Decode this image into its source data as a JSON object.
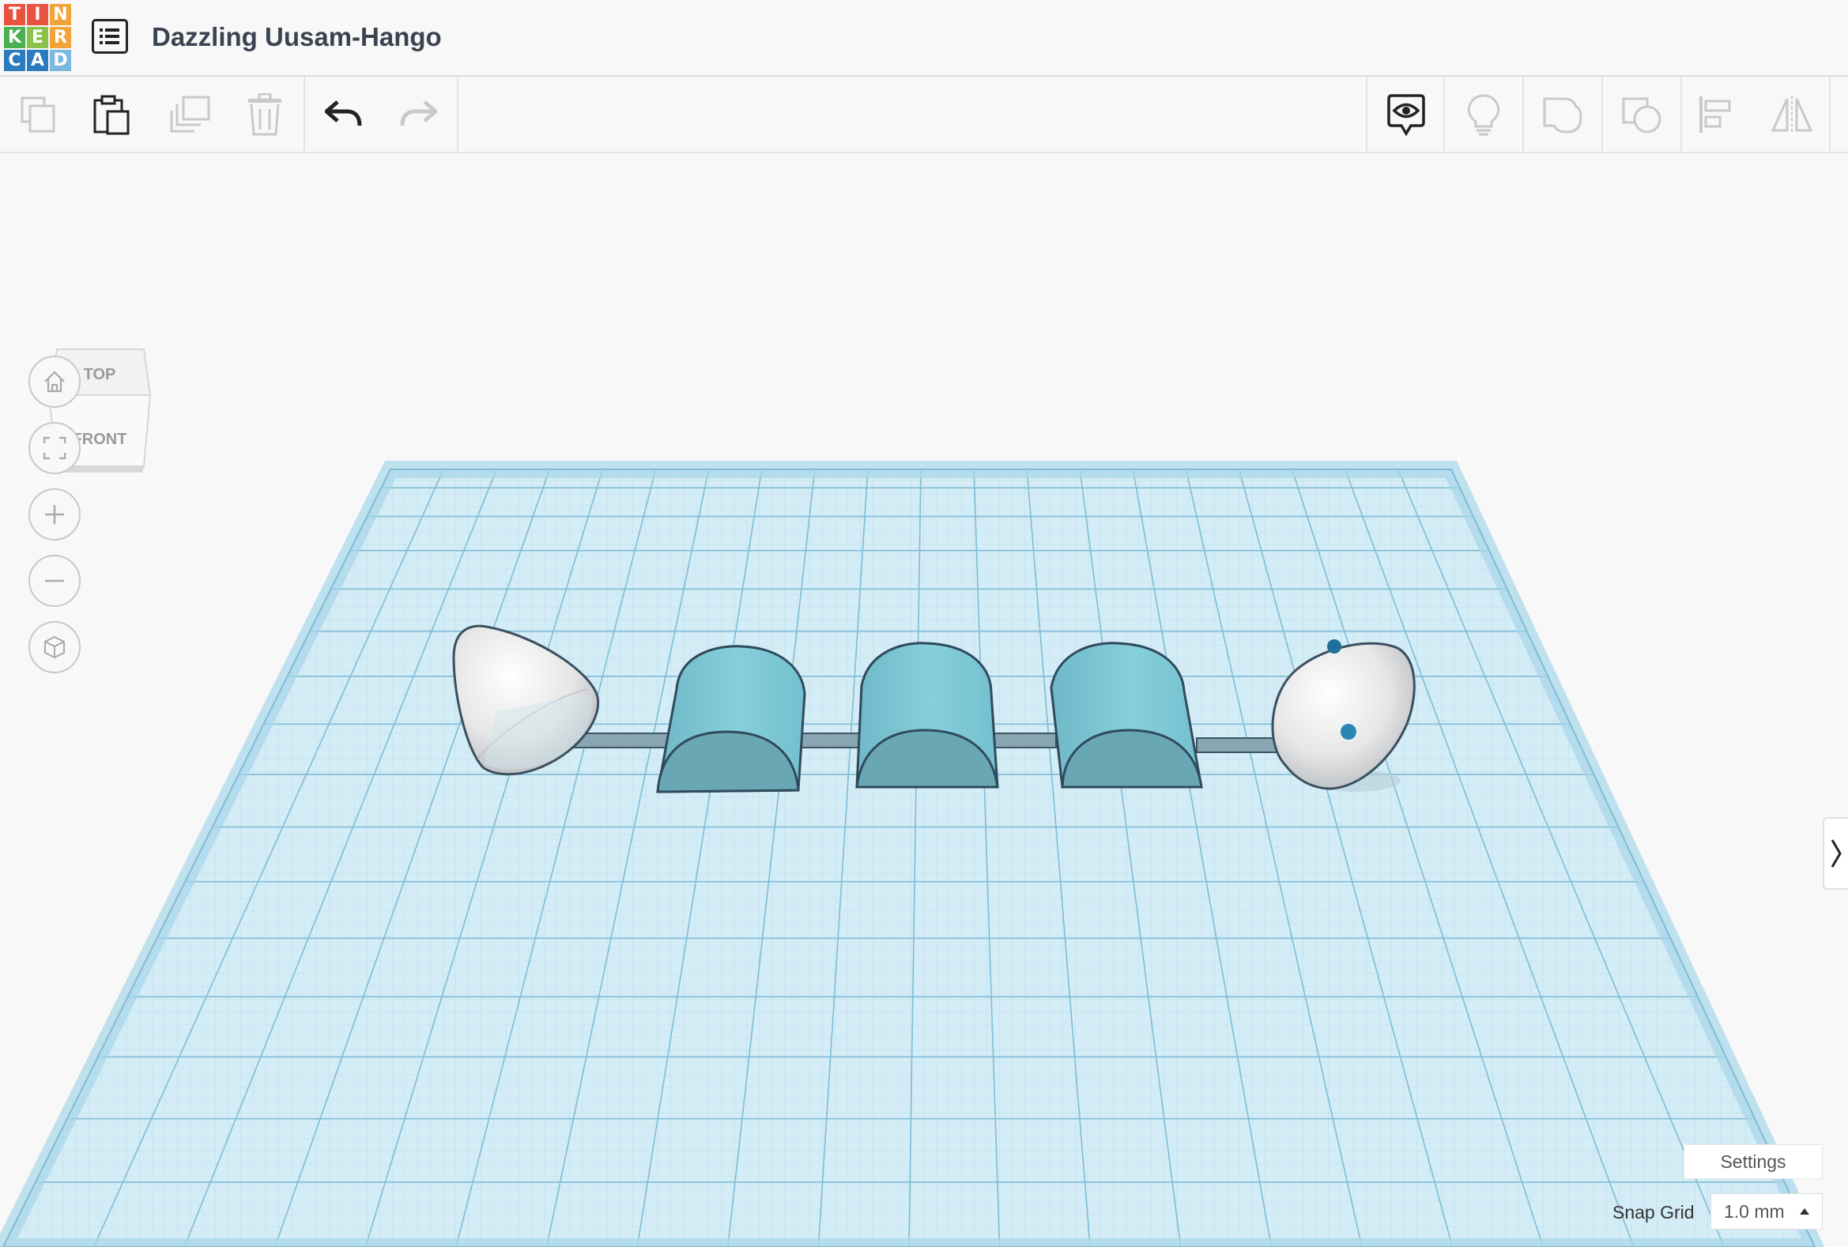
{
  "app": {
    "logo_letters": [
      "T",
      "I",
      "N",
      "K",
      "E",
      "R",
      "C",
      "A",
      "D"
    ],
    "logo_colors": [
      "#e8533f",
      "#e8533f",
      "#f2a33a",
      "#4caf50",
      "#8bc34a",
      "#2b7bbf",
      "#2b7bbf",
      "#2b7bbf",
      "#2b7bbf"
    ],
    "design_title": "Dazzling Uusam-Hango"
  },
  "toolbar": {
    "left_tools": [
      "copy-icon",
      "paste-icon",
      "duplicate-icon",
      "delete-icon",
      "undo-icon",
      "redo-icon"
    ],
    "right_tools": [
      "show-all-icon",
      "light-bulb-icon",
      "group-icon",
      "ungroup-icon",
      "align-icon",
      "mirror-icon"
    ]
  },
  "viewcube": {
    "top_label": "TOP",
    "front_label": "FRONT"
  },
  "view_controls": [
    "home-view-icon",
    "fit-all-icon",
    "zoom-in-icon",
    "zoom-out-icon",
    "perspective-icon"
  ],
  "workplane": {
    "grid_color": "#7fbcd6",
    "plane_color": "#cbe8f2",
    "shape_color": "#7ec8d6"
  },
  "footer": {
    "settings_label": "Settings",
    "snap_grid_label": "Snap Grid",
    "snap_grid_value": "1.0 mm"
  }
}
